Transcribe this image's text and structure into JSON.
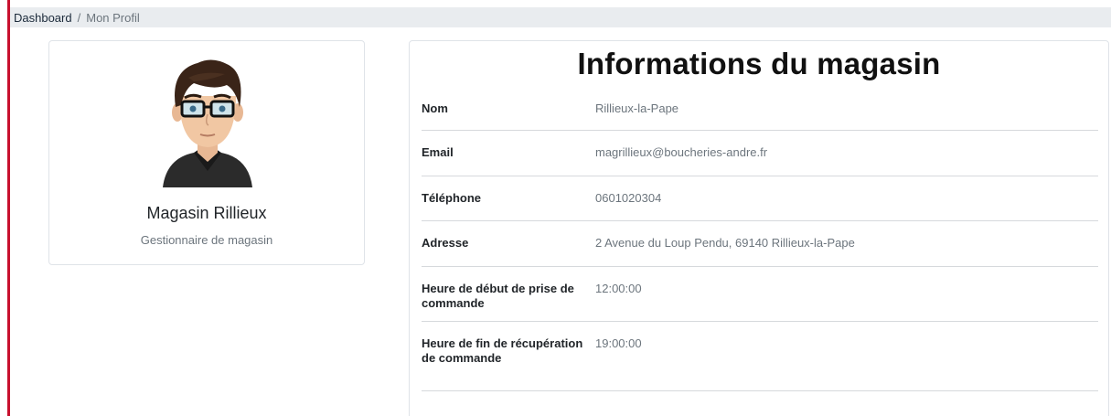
{
  "breadcrumb": {
    "home": "Dashboard",
    "separator": "/",
    "current": "Mon Profil"
  },
  "profile": {
    "name": "Magasin Rillieux",
    "role": "Gestionnaire de magasin",
    "avatar_icon": "cartoon-avatar-icon"
  },
  "info": {
    "title": "Informations du magasin",
    "rows": [
      {
        "label": "Nom",
        "value": "Rillieux-la-Pape"
      },
      {
        "label": "Email",
        "value": "magrillieux@boucheries-andre.fr"
      },
      {
        "label": "Téléphone",
        "value": "0601020304"
      },
      {
        "label": "Adresse",
        "value": "2 Avenue du Loup Pendu, 69140 Rillieux-la-Pape"
      },
      {
        "label": "Heure de début de prise de commande",
        "value": "12:00:00"
      },
      {
        "label": "Heure de fin de récupération de commande",
        "value": "19:00:00"
      }
    ]
  },
  "colors": {
    "accent": "#c8102e",
    "breadcrumb_bg": "#e9ecef",
    "muted_text": "#6c757d"
  }
}
